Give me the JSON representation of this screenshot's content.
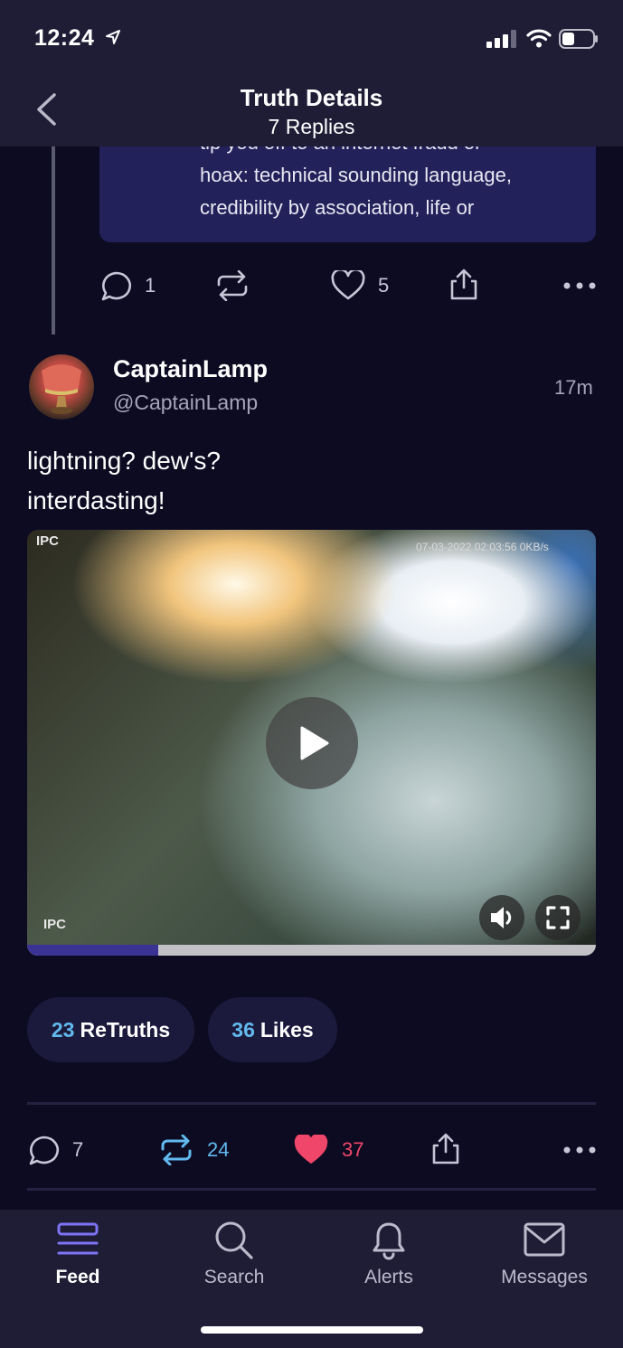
{
  "status_bar": {
    "time": "12:24"
  },
  "header": {
    "title": "Truth Details",
    "subtitle": "7 Replies"
  },
  "quoted_card": {
    "lines": [
      "tip you off to an internet fraud or",
      "hoax: technical sounding language,",
      "credibility by association, life or"
    ]
  },
  "reply_actions": {
    "replies": "1",
    "likes": "5"
  },
  "post": {
    "author": "CaptainLamp",
    "handle": "@CaptainLamp",
    "time_ago": "17m",
    "body_line1": "lightning? dew's?",
    "body_line2": "interdasting!",
    "video": {
      "overlay_top_left": "IPC",
      "overlay_bottom_left": "IPC",
      "overlay_top_right": "07-03-2022 02:03:56  0KB/s",
      "progress": 0.23
    }
  },
  "stats": {
    "retruths_count": "23",
    "retruths_label": "ReTruths",
    "likes_count": "36",
    "likes_label": "Likes"
  },
  "post_actions": {
    "replies": "7",
    "retruths": "24",
    "likes": "37"
  },
  "colors": {
    "accent_blue": "#62b9ee",
    "like_red": "#f0466a",
    "tab_active": "#7d74f5"
  },
  "tabbar": {
    "items": [
      {
        "label": "Feed",
        "icon": "feed-icon"
      },
      {
        "label": "Search",
        "icon": "search-icon"
      },
      {
        "label": "Alerts",
        "icon": "bell-icon"
      },
      {
        "label": "Messages",
        "icon": "envelope-icon"
      }
    ]
  }
}
